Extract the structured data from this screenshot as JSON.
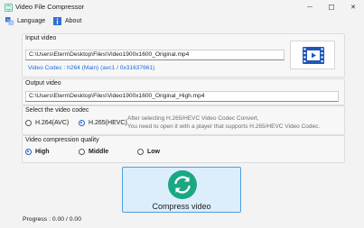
{
  "window": {
    "title": "Video File Compressor",
    "controls": {
      "minimize": "—",
      "maximize": "☐",
      "close": "✕"
    }
  },
  "menu": {
    "language": "Language",
    "about": "About"
  },
  "input_video": {
    "label": "Input video",
    "path": "C:\\Users\\Etern\\Desktop\\Files\\Video1900x1600_Original.mp4",
    "codec_info": "Video Codec : h264 (Main) (avc1 / 0x31637661)"
  },
  "output_video": {
    "label": "Output video",
    "path": "C:\\Users\\Etern\\Desktop\\Files\\Video1900x1600_Original_High.mp4"
  },
  "codec": {
    "label": "Select the video codec",
    "options": [
      {
        "label": "H.264(AVC)",
        "selected": false
      },
      {
        "label": "H.265(HEVC)",
        "selected": true
      }
    ],
    "note_line1": "After selecting H.265/HEVC Video Codec Convert,",
    "note_line2": "You need to open it with a player that supports H.265/HEVC Video Codec."
  },
  "quality": {
    "label": "Video compression quality",
    "options": [
      {
        "label": "High",
        "selected": true
      },
      {
        "label": "Middle",
        "selected": false
      },
      {
        "label": "Low",
        "selected": false
      }
    ]
  },
  "compress_button": {
    "label": "Compress video"
  },
  "progress": {
    "text": "Progress : 0.00 / 0.00"
  },
  "colors": {
    "accent": "#1f5fbf",
    "link_blue": "#1c6bd6",
    "compress_icon": "#1aa882",
    "button_bg": "#dceefc",
    "film_icon": "#1f57b8"
  },
  "icons": {
    "app": "video-compressor-app-icon",
    "language": "translate-icon",
    "about": "info-icon",
    "thumbnail": "film-strip-icon",
    "compress": "refresh-arrows-icon"
  }
}
